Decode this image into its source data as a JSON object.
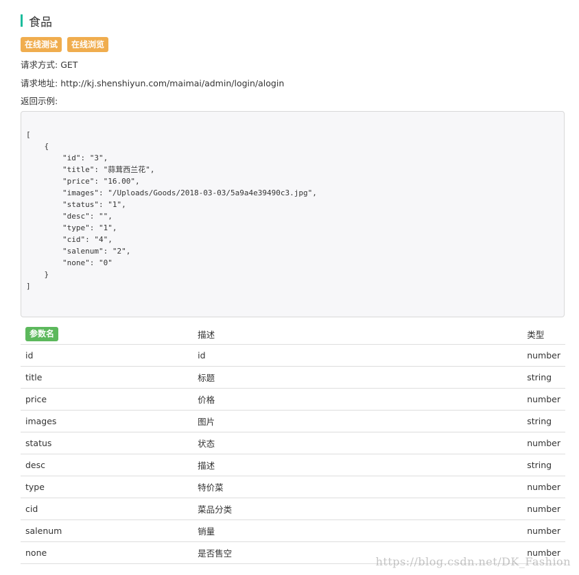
{
  "section": {
    "title": "食品"
  },
  "buttons": {
    "online_test": "在线测试",
    "online_browse": "在线浏览"
  },
  "request": {
    "method_label": "请求方式:",
    "method": "GET",
    "url_label": "请求地址:",
    "url": "http://kj.shenshiyun.com/maimai/admin/login/alogin",
    "example_label": "返回示例:"
  },
  "example_json": "[\n    {\n        \"id\": \"3\",\n        \"title\": \"蒜茸西兰花\",\n        \"price\": \"16.00\",\n        \"images\": \"/Uploads/Goods/2018-03-03/5a9a4e39490c3.jpg\",\n        \"status\": \"1\",\n        \"desc\": \"\",\n        \"type\": \"1\",\n        \"cid\": \"4\",\n        \"salenum\": \"2\",\n        \"none\": \"0\"\n    }\n]",
  "table": {
    "headers": {
      "name": "参数名",
      "desc": "描述",
      "type": "类型"
    },
    "rows": [
      {
        "name": "id",
        "desc": "id",
        "type": "number"
      },
      {
        "name": "title",
        "desc": "标题",
        "type": "string"
      },
      {
        "name": "price",
        "desc": "价格",
        "type": "number"
      },
      {
        "name": "images",
        "desc": "图片",
        "type": "string"
      },
      {
        "name": "status",
        "desc": "状态",
        "type": "number"
      },
      {
        "name": "desc",
        "desc": "描述",
        "type": "string"
      },
      {
        "name": "type",
        "desc": "特价菜",
        "type": "number"
      },
      {
        "name": "cid",
        "desc": "菜品分类",
        "type": "number"
      },
      {
        "name": "salenum",
        "desc": "销量",
        "type": "number"
      },
      {
        "name": "none",
        "desc": "是否售空",
        "type": "number"
      }
    ]
  },
  "watermark": "https://blog.csdn.net/DK_Fashion",
  "colors": {
    "accent_bar": "#1abc9c",
    "button_orange": "#f0ad4e",
    "badge_green": "#5cb85c"
  }
}
